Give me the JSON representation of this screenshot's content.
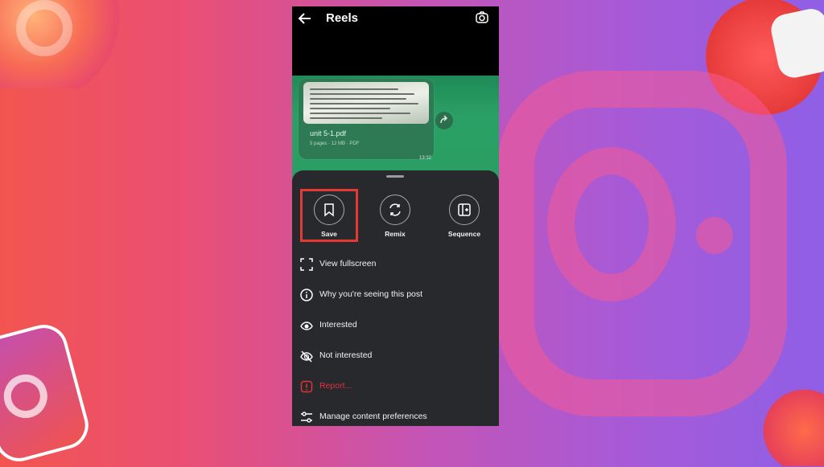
{
  "header": {
    "title": "Reels"
  },
  "reel": {
    "file_name": "unit 5-1.pdf",
    "file_meta": "5 pages · 12 MB · PDF",
    "time": "13:32"
  },
  "actions": [
    {
      "label": "Save",
      "icon": "bookmark-icon",
      "highlighted": true
    },
    {
      "label": "Remix",
      "icon": "remix-icon"
    },
    {
      "label": "Sequence",
      "icon": "sequence-icon"
    }
  ],
  "menu": [
    {
      "label": "View fullscreen",
      "icon": "fullscreen-icon"
    },
    {
      "label": "Why you're seeing this post",
      "icon": "info-icon"
    },
    {
      "label": "Interested",
      "icon": "eye-icon"
    },
    {
      "label": "Not interested",
      "icon": "eye-off-icon"
    },
    {
      "label": "Report...",
      "icon": "report-icon",
      "color": "#e5303a"
    },
    {
      "label": "Manage content preferences",
      "icon": "sliders-icon"
    }
  ],
  "colors": {
    "highlight": "#e53935",
    "sheet": "#27292c",
    "reel_bg": "#2ba066"
  }
}
